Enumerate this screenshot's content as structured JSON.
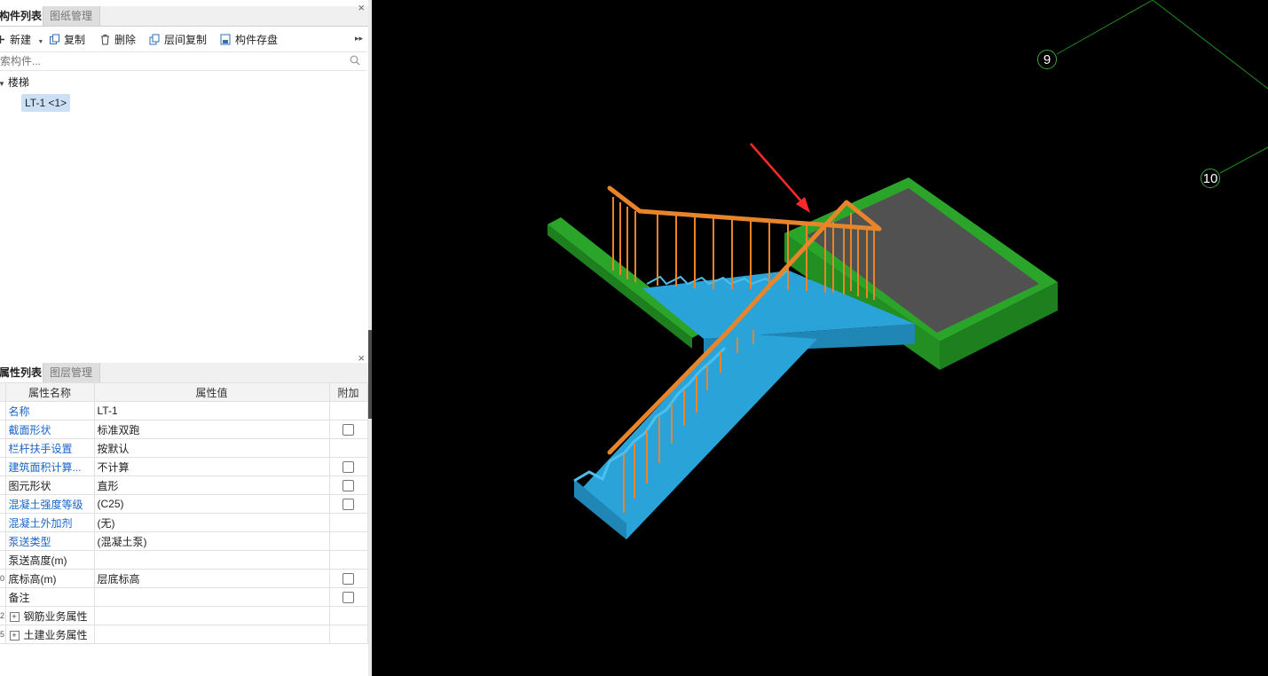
{
  "component_panel": {
    "tabs": [
      {
        "label": "构件列表",
        "active": true
      },
      {
        "label": "图纸管理",
        "active": false
      }
    ],
    "toolbar": {
      "new_label": "新建",
      "copy_label": "复制",
      "delete_label": "删除",
      "floor_copy_label": "层间复制",
      "save_component_label": "构件存盘"
    },
    "search": {
      "placeholder": "搜索构件..."
    },
    "tree": {
      "group_label": "楼梯",
      "item_label": "LT-1 <1>"
    }
  },
  "property_panel": {
    "tabs": [
      {
        "label": "属性列表",
        "active": true
      },
      {
        "label": "图层管理",
        "active": false
      }
    ],
    "headers": {
      "name": "属性名称",
      "value": "属性值",
      "extra": "附加"
    },
    "rows": [
      {
        "name": "名称",
        "value": "LT-1",
        "color": "blue",
        "checkbox": false,
        "expand": false,
        "num": ""
      },
      {
        "name": "截面形状",
        "value": "标准双跑",
        "color": "blue",
        "checkbox": true,
        "expand": false,
        "num": ""
      },
      {
        "name": "栏杆扶手设置",
        "value": "按默认",
        "color": "blue",
        "checkbox": false,
        "expand": false,
        "num": ""
      },
      {
        "name": "建筑面积计算...",
        "value": "不计算",
        "color": "blue",
        "checkbox": true,
        "expand": false,
        "num": ""
      },
      {
        "name": "图元形状",
        "value": "直形",
        "color": "black",
        "checkbox": true,
        "expand": false,
        "num": ""
      },
      {
        "name": "混凝土强度等级",
        "value": "(C25)",
        "color": "blue",
        "checkbox": true,
        "expand": false,
        "num": ""
      },
      {
        "name": "混凝土外加剂",
        "value": "(无)",
        "color": "blue",
        "checkbox": false,
        "expand": false,
        "num": ""
      },
      {
        "name": "泵送类型",
        "value": "(混凝土泵)",
        "color": "blue",
        "checkbox": false,
        "expand": false,
        "num": ""
      },
      {
        "name": "泵送高度(m)",
        "value": "",
        "color": "black",
        "checkbox": false,
        "expand": false,
        "num": ""
      },
      {
        "name": "底标高(m)",
        "value": "层底标高",
        "color": "black",
        "checkbox": true,
        "expand": false,
        "num": "0"
      },
      {
        "name": "备注",
        "value": "",
        "color": "black",
        "checkbox": true,
        "expand": false,
        "num": ""
      },
      {
        "name": "钢筋业务属性",
        "value": "",
        "color": "black",
        "checkbox": false,
        "expand": true,
        "num": "2"
      },
      {
        "name": "土建业务属性",
        "value": "",
        "color": "black",
        "checkbox": false,
        "expand": true,
        "num": "5"
      }
    ]
  },
  "viewport": {
    "grid_labels": [
      "9",
      "10"
    ]
  },
  "colors": {
    "landing_green": "#2aa52a",
    "stair_blue": "#2aa3d8",
    "railing_orange": "#e8842a",
    "slab_gray": "#515151",
    "arrow_red": "#ff2a2a",
    "link_blue": "#1a66c8"
  }
}
